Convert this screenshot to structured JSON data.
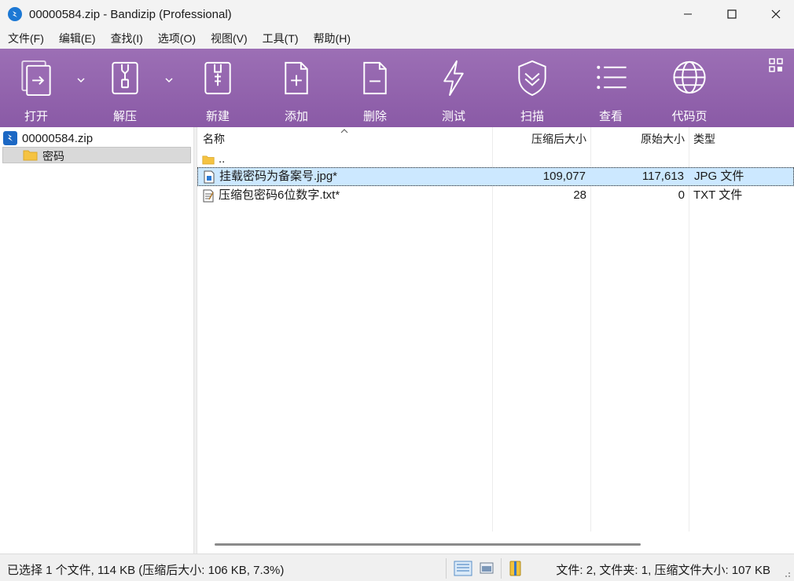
{
  "window": {
    "title": "00000584.zip - Bandizip (Professional)"
  },
  "menu": [
    "文件(F)",
    "编辑(E)",
    "查找(I)",
    "选项(O)",
    "视图(V)",
    "工具(T)",
    "帮助(H)"
  ],
  "toolbar": {
    "open": "打开",
    "extract": "解压",
    "new": "新建",
    "add": "添加",
    "delete": "删除",
    "test": "测试",
    "scan": "扫描",
    "view": "查看",
    "codepage": "代码页"
  },
  "tree": {
    "root": "00000584.zip",
    "children": [
      "密码"
    ]
  },
  "list": {
    "headers": {
      "name": "名称",
      "compressed": "压缩后大小",
      "original": "原始大小",
      "type": "类型"
    },
    "parent": "..",
    "rows": [
      {
        "name": "挂载密码为备案号.jpg*",
        "compressed": "109,077",
        "original": "117,613",
        "type": "JPG 文件",
        "selected": true
      },
      {
        "name": "压缩包密码6位数字.txt*",
        "compressed": "28",
        "original": "0",
        "type": "TXT 文件",
        "selected": false
      }
    ]
  },
  "status": {
    "left": "已选择 1 个文件, 114 KB (压缩后大小: 106 KB, 7.3%)",
    "right": "文件: 2, 文件夹: 1, 压缩文件大小: 107 KB"
  },
  "colors": {
    "toolbar": "#9465af",
    "selection": "#cce8ff",
    "accent": "#1c78d4"
  }
}
